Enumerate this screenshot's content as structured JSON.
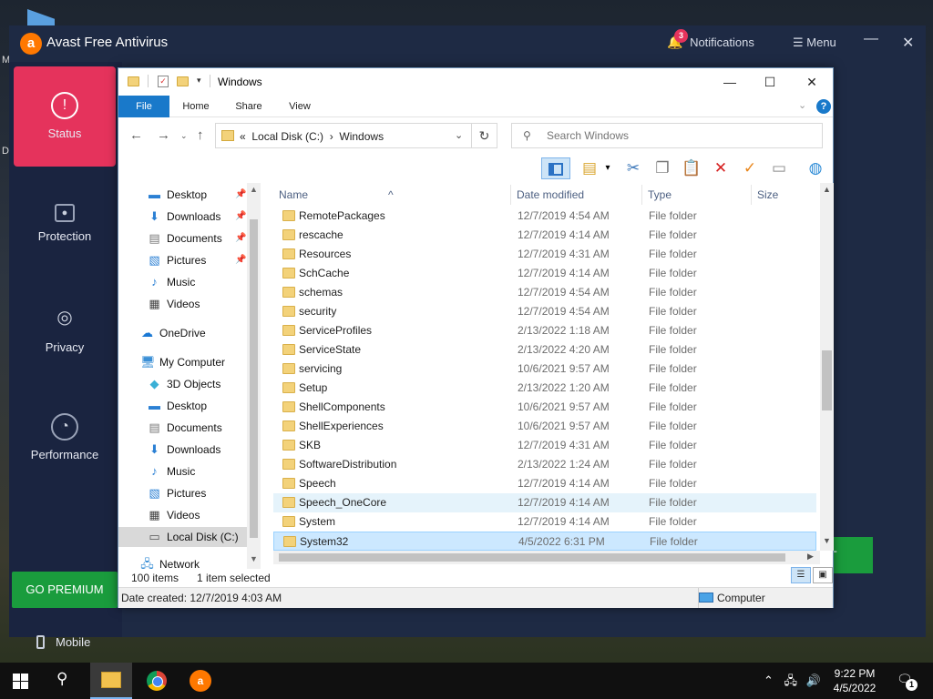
{
  "desktop": {
    "edge_text_1": "M",
    "edge_text_2": "D"
  },
  "avast": {
    "title": "Avast Free Antivirus",
    "notifications_count": "3",
    "notifications_label": "Notifications",
    "menu_label": "☰ Menu",
    "nav": [
      {
        "label": "Status",
        "icon": "alert-circle-icon",
        "active": true
      },
      {
        "label": "Protection",
        "icon": "lock-icon"
      },
      {
        "label": "Privacy",
        "icon": "fingerprint-icon"
      },
      {
        "label": "Performance",
        "icon": "gauge-icon"
      }
    ],
    "go_premium": "GO PREMIUM",
    "mobile": "Mobile",
    "right_button_fragment": "T"
  },
  "explorer": {
    "title": "Windows",
    "ribbon_tabs": [
      "File",
      "Home",
      "Share",
      "View"
    ],
    "address": {
      "prefix": "«",
      "segments": [
        "Local Disk (C:)",
        "Windows"
      ]
    },
    "search_placeholder": "Search Windows",
    "nav_pane": [
      {
        "label": "Desktop",
        "icon": "desktop-icon",
        "pinned": true
      },
      {
        "label": "Downloads",
        "icon": "downloads-icon",
        "pinned": true
      },
      {
        "label": "Documents",
        "icon": "documents-icon",
        "pinned": true
      },
      {
        "label": "Pictures",
        "icon": "pictures-icon",
        "pinned": true
      },
      {
        "label": "Music",
        "icon": "music-icon"
      },
      {
        "label": "Videos",
        "icon": "videos-icon"
      },
      {
        "label": "OneDrive",
        "icon": "onedrive-icon"
      },
      {
        "label": "My Computer",
        "icon": "computer-icon"
      },
      {
        "label": "3D Objects",
        "icon": "3d-objects-icon"
      },
      {
        "label": "Desktop",
        "icon": "desktop-icon"
      },
      {
        "label": "Documents",
        "icon": "documents-icon"
      },
      {
        "label": "Downloads",
        "icon": "downloads-icon"
      },
      {
        "label": "Music",
        "icon": "music-icon"
      },
      {
        "label": "Pictures",
        "icon": "pictures-icon"
      },
      {
        "label": "Videos",
        "icon": "videos-icon"
      },
      {
        "label": "Local Disk (C:)",
        "icon": "drive-icon",
        "selected": true
      },
      {
        "label": "Network",
        "icon": "network-icon"
      }
    ],
    "columns": [
      "Name",
      "Date modified",
      "Type",
      "Size"
    ],
    "files": [
      {
        "name": "RemotePackages",
        "date": "12/7/2019 4:54 AM",
        "type": "File folder"
      },
      {
        "name": "rescache",
        "date": "12/7/2019 4:14 AM",
        "type": "File folder"
      },
      {
        "name": "Resources",
        "date": "12/7/2019 4:31 AM",
        "type": "File folder"
      },
      {
        "name": "SchCache",
        "date": "12/7/2019 4:14 AM",
        "type": "File folder"
      },
      {
        "name": "schemas",
        "date": "12/7/2019 4:54 AM",
        "type": "File folder"
      },
      {
        "name": "security",
        "date": "12/7/2019 4:54 AM",
        "type": "File folder"
      },
      {
        "name": "ServiceProfiles",
        "date": "2/13/2022 1:18 AM",
        "type": "File folder"
      },
      {
        "name": "ServiceState",
        "date": "2/13/2022 4:20 AM",
        "type": "File folder"
      },
      {
        "name": "servicing",
        "date": "10/6/2021 9:57 AM",
        "type": "File folder"
      },
      {
        "name": "Setup",
        "date": "2/13/2022 1:20 AM",
        "type": "File folder"
      },
      {
        "name": "ShellComponents",
        "date": "10/6/2021 9:57 AM",
        "type": "File folder"
      },
      {
        "name": "ShellExperiences",
        "date": "10/6/2021 9:57 AM",
        "type": "File folder"
      },
      {
        "name": "SKB",
        "date": "12/7/2019 4:31 AM",
        "type": "File folder"
      },
      {
        "name": "SoftwareDistribution",
        "date": "2/13/2022 1:24 AM",
        "type": "File folder"
      },
      {
        "name": "Speech",
        "date": "12/7/2019 4:14 AM",
        "type": "File folder"
      },
      {
        "name": "Speech_OneCore",
        "date": "12/7/2019 4:14 AM",
        "type": "File folder",
        "hover": true
      },
      {
        "name": "System",
        "date": "12/7/2019 4:14 AM",
        "type": "File folder"
      },
      {
        "name": "System32",
        "date": "4/5/2022 6:31 PM",
        "type": "File folder",
        "selected": true
      }
    ],
    "item_count": "100 items",
    "selection": "1 item selected",
    "details": "Date created: 12/7/2019 4:03 AM",
    "location": "Computer"
  },
  "taskbar": {
    "time": "9:22 PM",
    "date": "4/5/2022",
    "action_center_count": "1"
  }
}
